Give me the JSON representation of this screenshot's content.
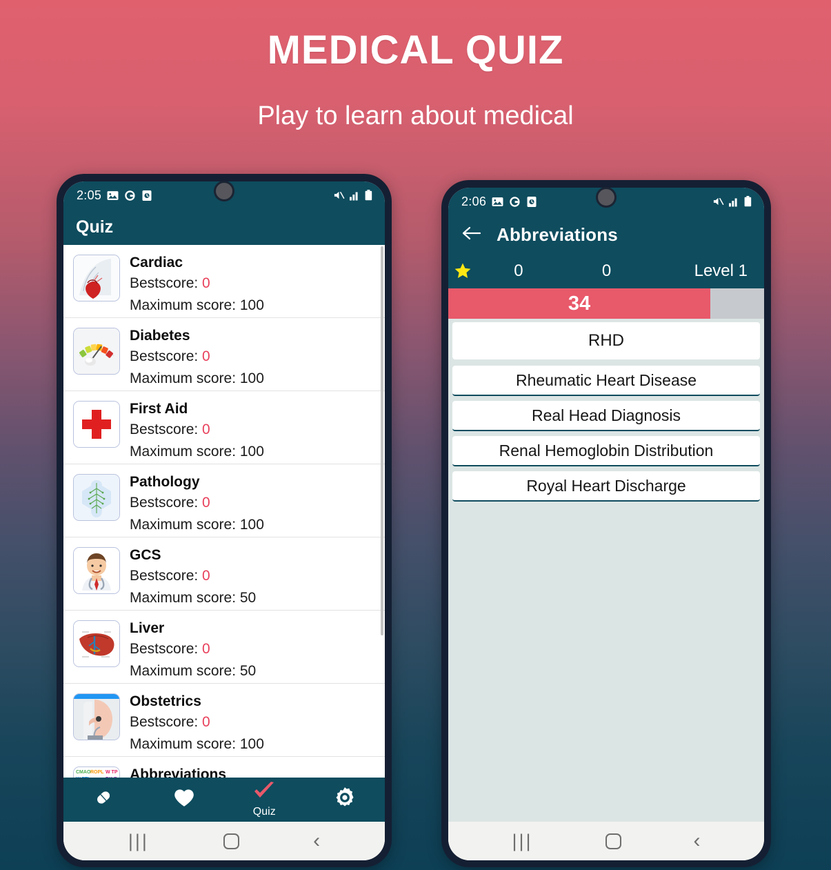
{
  "header": {
    "title": "MEDICAL  QUIZ",
    "subtitle": "Play to learn about medical"
  },
  "colors": {
    "background_top": "#e0606e",
    "background_bottom": "#0d3f55",
    "app_bar": "#0e4c5e",
    "accent_red": "#e8596a",
    "score_red": "#e8415c",
    "play_background": "#dbe5e4",
    "phone_bezel": "#151f33"
  },
  "left_phone": {
    "status_bar": {
      "time": "2:05",
      "icons_left": [
        "image-icon",
        "google-icon",
        "clock-app-icon"
      ],
      "icons_right": [
        "mute-icon",
        "signal-icon",
        "battery-icon"
      ]
    },
    "app_bar": {
      "title": "Quiz"
    },
    "list": {
      "best_label": "Bestscore: ",
      "max_label": "Maximum score: ",
      "items": [
        {
          "title": "Cardiac",
          "bestscore": "0",
          "max": "100",
          "icon": "cardiac-thumb"
        },
        {
          "title": "Diabetes",
          "bestscore": "0",
          "max": "100",
          "icon": "diabetes-thumb"
        },
        {
          "title": "First Aid",
          "bestscore": "0",
          "max": "100",
          "icon": "first-aid-thumb"
        },
        {
          "title": "Pathology",
          "bestscore": "0",
          "max": "100",
          "icon": "pathology-thumb"
        },
        {
          "title": "GCS",
          "bestscore": "0",
          "max": "50",
          "icon": "gcs-thumb"
        },
        {
          "title": "Liver",
          "bestscore": "0",
          "max": "50",
          "icon": "liver-thumb"
        },
        {
          "title": "Obstetrics",
          "bestscore": "0",
          "max": "100",
          "icon": "obstetrics-thumb"
        },
        {
          "title": "Abbreviations",
          "bestscore": "",
          "max": "",
          "icon": "abbreviations-thumb"
        }
      ]
    },
    "bottom_nav": {
      "items": [
        {
          "label": "",
          "icon": "pill-icon",
          "active": false
        },
        {
          "label": "",
          "icon": "heart-icon",
          "active": false
        },
        {
          "label": "Quiz",
          "icon": "checkmark-icon",
          "active": true
        },
        {
          "label": "",
          "icon": "gear-icon",
          "active": false
        }
      ]
    },
    "gesture_bar": {
      "recent": "|||",
      "home": "home-icon",
      "back": "‹"
    }
  },
  "right_phone": {
    "status_bar": {
      "time": "2:06",
      "icons_left": [
        "image-icon",
        "google-icon",
        "clock-app-icon"
      ],
      "icons_right": [
        "mute-icon",
        "signal-icon",
        "battery-icon"
      ]
    },
    "app_bar": {
      "back": "back-arrow-icon",
      "title": "Abbreviations"
    },
    "stats": {
      "star": "star-icon",
      "score": "0",
      "lives": "0",
      "level": "Level 1"
    },
    "timer": {
      "value": "34",
      "percent": 83
    },
    "question": {
      "text": "RHD"
    },
    "answers": [
      {
        "text": "Rheumatic Heart Disease"
      },
      {
        "text": "Real Head Diagnosis"
      },
      {
        "text": "Renal Hemoglobin Distribution"
      },
      {
        "text": "Royal Heart Discharge"
      }
    ],
    "gesture_bar": {
      "recent": "|||",
      "home": "home-icon",
      "back": "‹"
    }
  }
}
